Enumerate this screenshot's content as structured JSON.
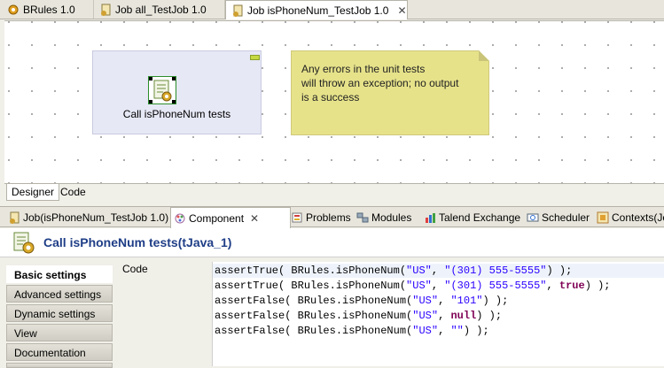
{
  "editor_tabs": [
    {
      "label": "BRules 1.0",
      "icon": "routine-icon"
    },
    {
      "label": "Job all_TestJob 1.0",
      "icon": "job-icon"
    },
    {
      "label": "Job isPhoneNum_TestJob 1.0",
      "icon": "job-icon",
      "active": true
    }
  ],
  "canvas": {
    "component_label": "Call isPhoneNum tests",
    "note_lines": [
      "Any errors in the unit tests",
      "will throw an exception; no output",
      "is a success"
    ]
  },
  "designer_tabs": [
    "Designer",
    "Code"
  ],
  "view_tabs": [
    {
      "label": "Job(isPhoneNum_TestJob 1.0)",
      "icon": "job-icon"
    },
    {
      "label": "Component",
      "icon": "component-icon",
      "active": true
    },
    {
      "label": "Problems",
      "icon": "problems-icon"
    },
    {
      "label": "Modules",
      "icon": "modules-icon"
    },
    {
      "label": "Talend Exchange",
      "icon": "exchange-icon"
    },
    {
      "label": "Scheduler",
      "icon": "scheduler-icon"
    },
    {
      "label": "Contexts(Jo",
      "icon": "contexts-icon"
    }
  ],
  "component": {
    "title": "Call isPhoneNum tests(tJava_1)",
    "settings": [
      "Basic settings",
      "Advanced settings",
      "Dynamic settings",
      "View",
      "Documentation"
    ],
    "code_label": "Code",
    "code_lines": [
      [
        {
          "t": "assertTrue( BRules.isPhoneNum("
        },
        {
          "t": "\"US\"",
          "c": "str"
        },
        {
          "t": ", "
        },
        {
          "t": "\"(301) 555-5555\"",
          "c": "str"
        },
        {
          "t": ") );"
        }
      ],
      [
        {
          "t": "assertTrue( BRules.isPhoneNum("
        },
        {
          "t": "\"US\"",
          "c": "str"
        },
        {
          "t": ", "
        },
        {
          "t": "\"(301) 555-5555\"",
          "c": "str"
        },
        {
          "t": ", "
        },
        {
          "t": "true",
          "c": "kw"
        },
        {
          "t": ") );"
        }
      ],
      [
        {
          "t": "assertFalse( BRules.isPhoneNum("
        },
        {
          "t": "\"US\"",
          "c": "str"
        },
        {
          "t": ", "
        },
        {
          "t": "\"101\"",
          "c": "str"
        },
        {
          "t": ") );"
        }
      ],
      [
        {
          "t": "assertFalse( BRules.isPhoneNum("
        },
        {
          "t": "\"US\"",
          "c": "str"
        },
        {
          "t": ", "
        },
        {
          "t": "null",
          "c": "kw"
        },
        {
          "t": ") );"
        }
      ],
      [
        {
          "t": "assertFalse( BRules.isPhoneNum("
        },
        {
          "t": "\"US\"",
          "c": "str"
        },
        {
          "t": ", "
        },
        {
          "t": "\"\"",
          "c": "str"
        },
        {
          "t": ") );"
        }
      ]
    ]
  }
}
